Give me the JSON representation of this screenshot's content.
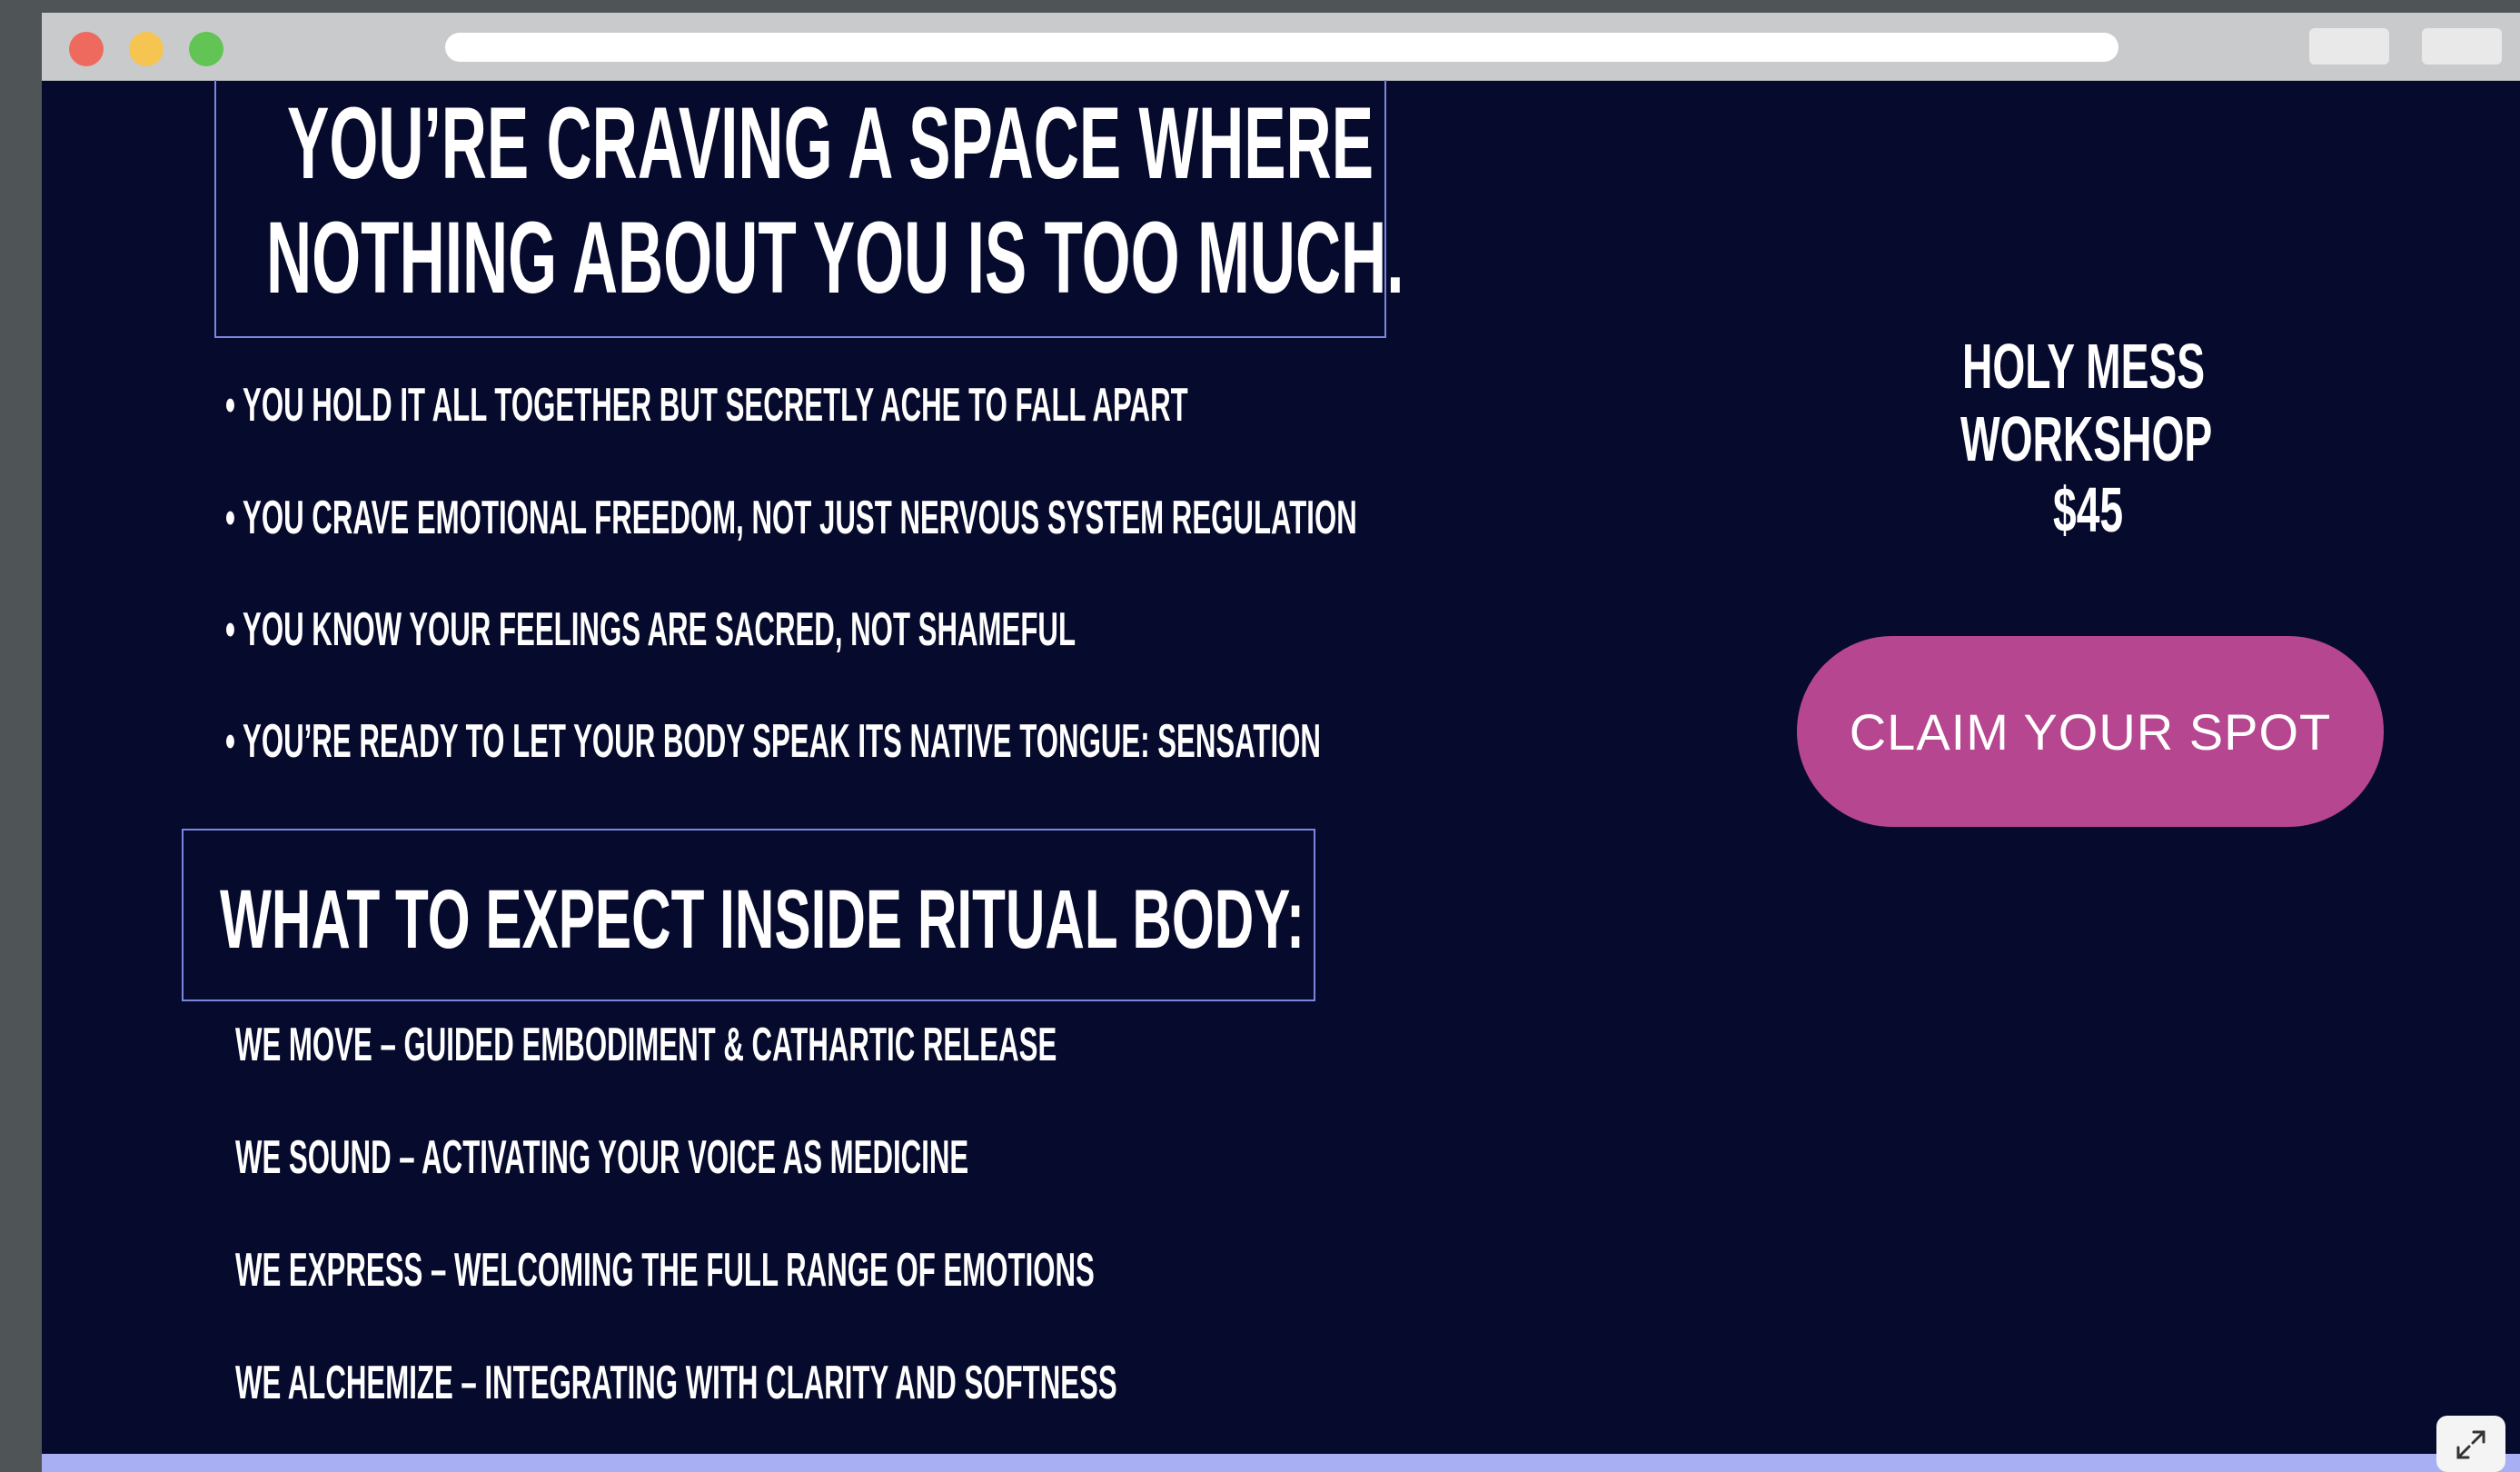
{
  "headline": {
    "line1": "YOU’RE CRAVING A SPACE WHERE",
    "line2": "NOTHING ABOUT YOU IS TOO MUCH."
  },
  "bullets": [
    "• YOU HOLD IT ALL TOGETHER BUT SECRETLY ACHE TO FALL APART",
    "• YOU CRAVE EMOTIONAL FREEDOM, NOT JUST NERVOUS SYSTEM REGULATION",
    "• YOU KNOW YOUR FEELINGS ARE SACRED, NOT SHAMEFUL",
    "• YOU’RE READY TO LET YOUR BODY SPEAK ITS NATIVE TONGUE: SENSATION"
  ],
  "section": {
    "title": "WHAT TO EXPECT INSIDE RITUAL BODY:",
    "items": [
      "WE MOVE – GUIDED EMBODIMENT & CATHARTIC   RELEASE",
      "WE SOUND – ACTIVATING YOUR VOICE AS MEDICINE",
      "WE EXPRESS – WELCOMING THE FULL RANGE OF EMOTIONS",
      "WE ALCHEMIZE – INTEGRATING WITH CLARITY AND SOFTNESS"
    ]
  },
  "offer": {
    "line1": "HOLY MESS",
    "line2": "WORKSHOP",
    "price": "$45",
    "cta_label": "CLAIM YOUR SPOT"
  },
  "colors": {
    "page_background": "#060a2c",
    "accent_border": "#7c86e0",
    "cta_background": "#b5468f",
    "bottom_bar": "#a8b0f3"
  },
  "icons": {
    "expand": "expand-arrows-icon"
  }
}
